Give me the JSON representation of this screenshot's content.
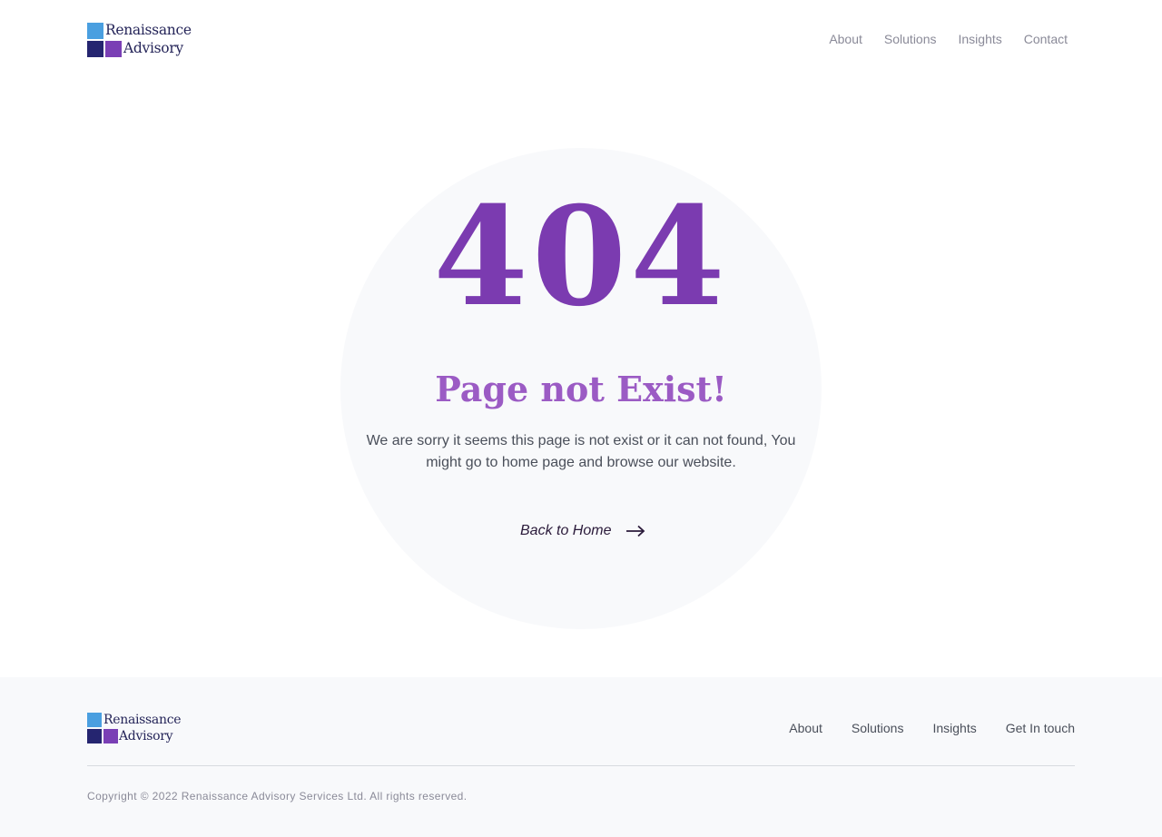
{
  "brand": {
    "line1": "Renaissance",
    "line2": "Advisory",
    "colors": {
      "light_blue": "#4a9fe0",
      "navy": "#252570",
      "purple": "#7a3fb5"
    }
  },
  "header": {
    "nav": [
      "About",
      "Solutions",
      "Insights",
      "Contact"
    ]
  },
  "hero": {
    "code": "404",
    "title": "Page not Exist!",
    "description": "We are sorry it seems this page is not exist or it can not found, You might go to home page and browse our website.",
    "back_label": "Back to Home",
    "back_icon": "arrow-right-icon",
    "accent_color": "#7b3bb0"
  },
  "footer": {
    "nav": [
      "About",
      "Solutions",
      "Insights",
      "Get In touch"
    ],
    "copyright": "Copyright © 2022 Renaissance Advisory Services Ltd. All rights reserved."
  }
}
